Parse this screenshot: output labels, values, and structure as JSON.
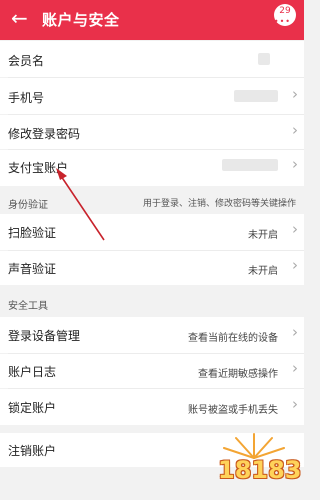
{
  "header": {
    "back_icon": "←",
    "title": "账户与安全",
    "badge_count": "29",
    "badge_dots": "•••"
  },
  "rows": {
    "member_name": {
      "label": "会员名"
    },
    "phone": {
      "label": "手机号",
      "chevron": "›"
    },
    "change_password": {
      "label": "修改登录密码",
      "chevron": "›"
    },
    "alipay": {
      "label": "支付宝账户",
      "chevron": "›"
    }
  },
  "identity_section": {
    "label": "身份验证",
    "hint": "用于登录、注销、修改密码等关键操作"
  },
  "identity_rows": {
    "face": {
      "label": "扫脸验证",
      "value": "未开启",
      "chevron": "›"
    },
    "voice": {
      "label": "声音验证",
      "value": "未开启",
      "chevron": "›"
    }
  },
  "tools_section": {
    "label": "安全工具"
  },
  "tool_rows": {
    "device": {
      "label": "登录设备管理",
      "value": "查看当前在线的设备",
      "chevron": "›"
    },
    "log": {
      "label": "账户日志",
      "value": "查看近期敏感操作",
      "chevron": "›"
    },
    "lock": {
      "label": "锁定账户",
      "value": "账号被盗或手机丢失",
      "chevron": "›"
    }
  },
  "cancel_row": {
    "label": "注销账户"
  },
  "watermark": {
    "text": "18183"
  },
  "colors": {
    "accent": "#e9304a",
    "arrow": "#c8232c"
  }
}
